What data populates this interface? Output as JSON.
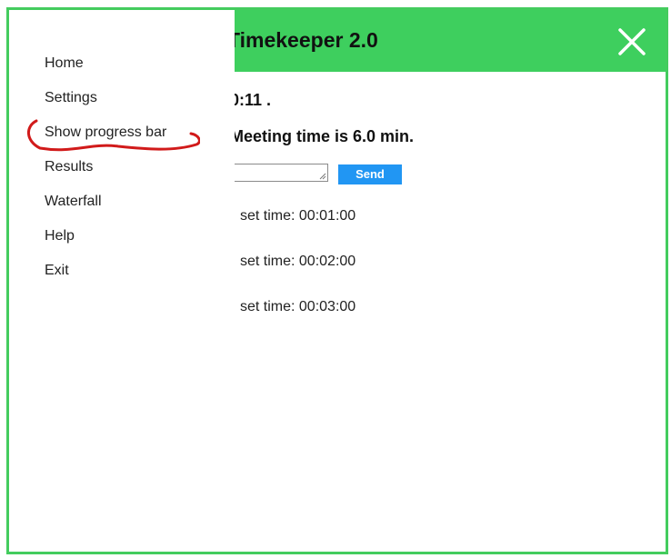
{
  "header": {
    "title": "Timekeeper 2.0",
    "close_icon": "close-icon"
  },
  "main": {
    "clock_text": "0:11 .",
    "meeting_text": "Meeting time is 6.0 min.",
    "input_value": "",
    "send_label": "Send",
    "set_times": [
      "set time: 00:01:00",
      "set time: 00:02:00",
      "set time: 00:03:00"
    ]
  },
  "sidebar": {
    "items": [
      {
        "label": "Home"
      },
      {
        "label": "Settings"
      },
      {
        "label": "Show progress bar"
      },
      {
        "label": "Results"
      },
      {
        "label": "Waterfall"
      },
      {
        "label": "Help"
      },
      {
        "label": "Exit"
      }
    ]
  },
  "colors": {
    "header_green": "#3ecf5e",
    "border_green": "#44cc5e",
    "send_blue": "#2196f3",
    "annotation_red": "#d11a1a"
  }
}
